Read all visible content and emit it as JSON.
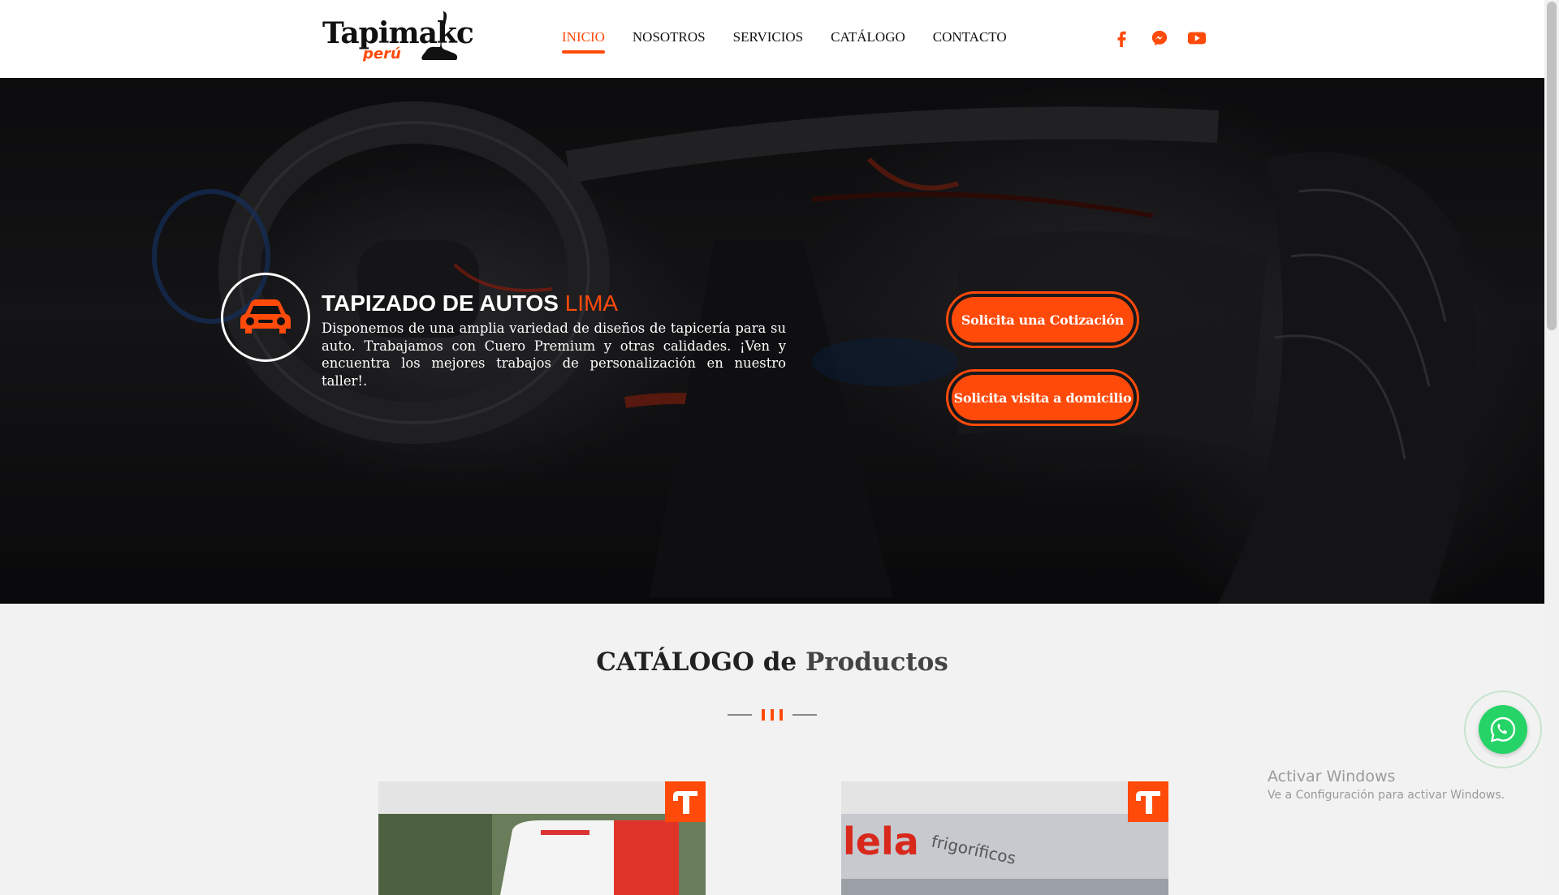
{
  "header": {
    "logo": {
      "text_main": "Tapimakc",
      "text_sub": "perú"
    },
    "nav": [
      {
        "label": "INICIO",
        "active": true
      },
      {
        "label": "NOSOTROS",
        "active": false
      },
      {
        "label": "SERVICIOS",
        "active": false
      },
      {
        "label": "CATÁLOGO",
        "active": false
      },
      {
        "label": "CONTACTO",
        "active": false
      }
    ],
    "socials": [
      "facebook-icon",
      "messenger-icon",
      "youtube-icon"
    ]
  },
  "hero": {
    "title_main": "TAPIZADO DE AUTOS",
    "title_accent": "LIMA",
    "description": "Disponemos de una amplia variedad de diseños de tapicería para su auto. Trabajamos con Cuero Premium y otras calidades. ¡Ven y encuentra los mejores trabajos de personalización en nuestro taller!.",
    "icon": "car-icon",
    "buttons": {
      "quote": "Solicita una Cotización",
      "visit": "Solicita visita a domicilio"
    }
  },
  "catalog": {
    "title_first": "CATÁLOGO de",
    "title_second": "Productos",
    "cards": [
      {
        "badge_icon": "brand-t-icon"
      },
      {
        "badge_icon": "brand-t-icon"
      }
    ]
  },
  "whatsapp": {
    "icon": "whatsapp-icon"
  },
  "windows_watermark": {
    "title": "Activar Windows",
    "subtitle": "Ve a Configuración para activar Windows."
  },
  "colors": {
    "accent": "#ff4a0a",
    "whatsapp": "#25d366",
    "header_bg": "#ffffff",
    "page_bg": "#f2f2f2"
  }
}
